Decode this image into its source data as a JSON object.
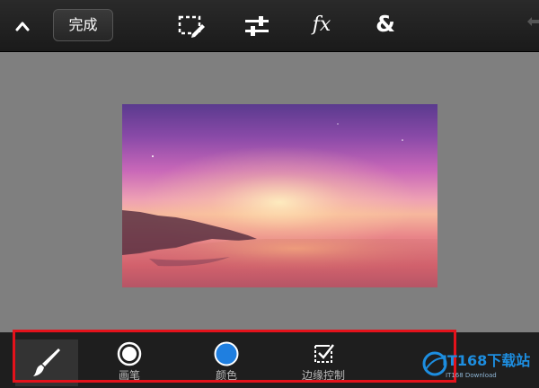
{
  "toolbar": {
    "done_label": "完成",
    "fx_label": "fx",
    "amp_label": "&"
  },
  "brush_options": [
    {
      "label": "画笔",
      "icon": "brush-size-icon"
    },
    {
      "label": "颜色",
      "icon": "color-dot-icon"
    },
    {
      "label": "边缘控制",
      "icon": "edge-control-icon"
    }
  ],
  "colors": {
    "accent_blue": "#1f7fe0",
    "highlight_red": "#e3121b"
  },
  "watermark": {
    "text": "IT168下载站",
    "sub": "IT168 Download"
  }
}
